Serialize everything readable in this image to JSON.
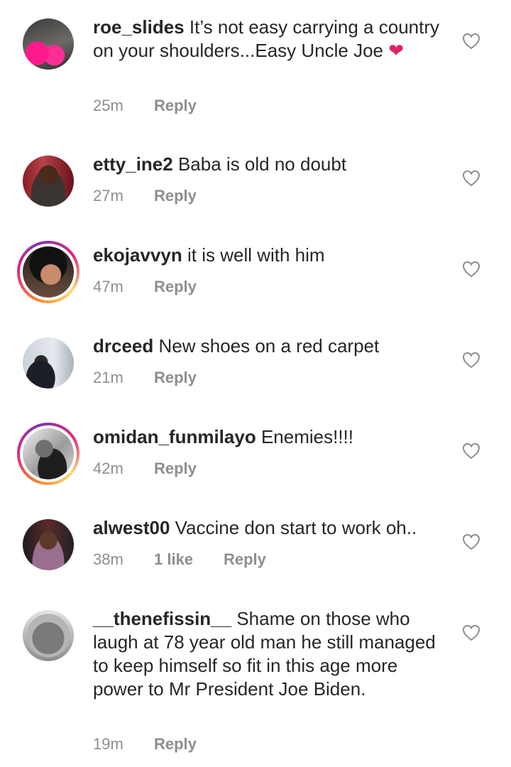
{
  "comments": [
    {
      "username": "roe_slides",
      "text": "It’s not easy carrying a country on your shoulders...Easy Uncle Joe",
      "emoji": "❤",
      "time": "25m",
      "likes": "",
      "reply": "Reply",
      "story_ring": false
    },
    {
      "username": "etty_ine2",
      "text": "Baba is old no doubt",
      "time": "27m",
      "likes": "",
      "reply": "Reply",
      "story_ring": false
    },
    {
      "username": "ekojavvyn",
      "text": "it is well with him",
      "time": "47m",
      "likes": "",
      "reply": "Reply",
      "story_ring": true
    },
    {
      "username": "drceed",
      "text": "New shoes on a red carpet",
      "time": "21m",
      "likes": "",
      "reply": "Reply",
      "story_ring": false
    },
    {
      "username": "omidan_funmilayo",
      "text": "Enemies!!!!",
      "time": "42m",
      "likes": "",
      "reply": "Reply",
      "story_ring": true
    },
    {
      "username": "alwest00",
      "text": "Vaccine don start to work oh..",
      "time": "38m",
      "likes": "1 like",
      "reply": "Reply",
      "story_ring": false
    },
    {
      "username": "__thenefissin__",
      "text": "Shame on those who laugh at 78 year old man he still managed to keep himself so fit in this age more power to Mr President Joe Biden.",
      "time": "19m",
      "likes": "",
      "reply": "Reply",
      "story_ring": false
    }
  ],
  "colors": {
    "text": "#262626",
    "meta": "#8e8e8e",
    "heart_emoji": "#e0245e"
  }
}
